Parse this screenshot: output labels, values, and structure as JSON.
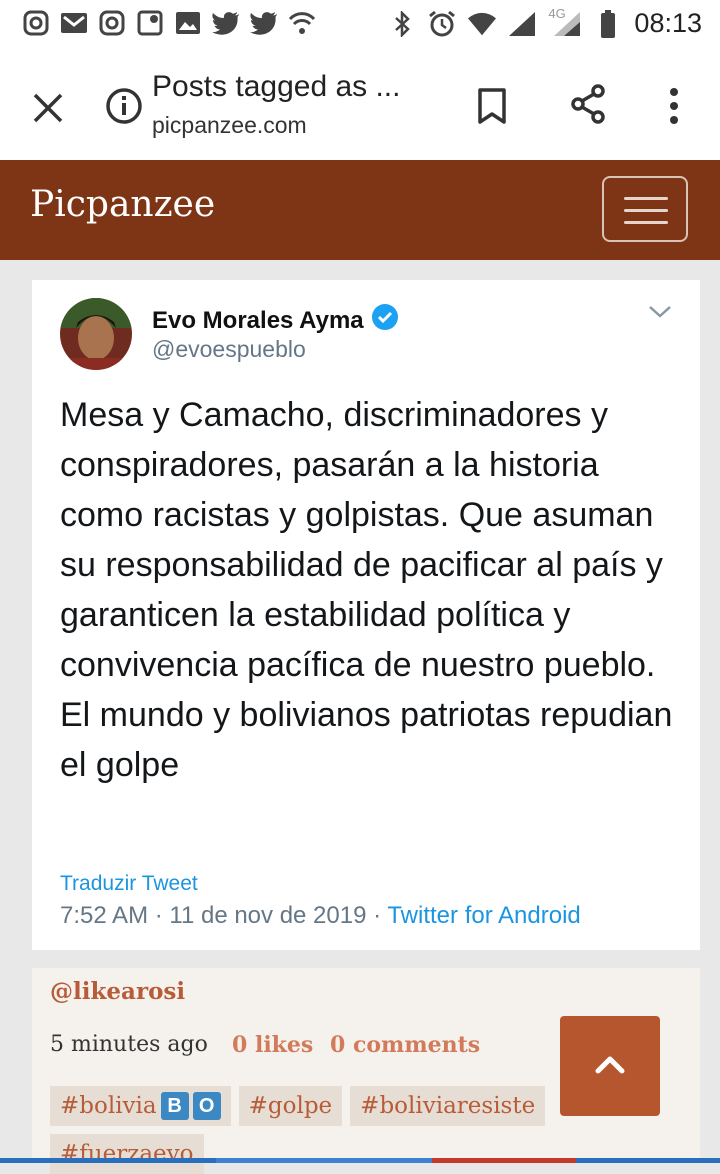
{
  "status_bar": {
    "time": "08:13",
    "network": "4G",
    "left_icons": [
      "instagram-icon",
      "gmail-icon",
      "instagram-icon",
      "maps-icon",
      "image-icon",
      "twitter-icon",
      "twitter-icon",
      "vpn-icon"
    ],
    "right_icons": [
      "bluetooth-icon",
      "alarm-icon",
      "wifi-icon",
      "signal-icon",
      "signal-4g-icon",
      "battery-icon"
    ]
  },
  "toolbar": {
    "title": "Posts tagged as ...",
    "url": "picpanzee.com"
  },
  "site": {
    "brand": "Picpanzee",
    "header_color": "#7e3516"
  },
  "tweet": {
    "name": "Evo Morales Ayma",
    "handle": "@evoespueblo",
    "text": "Mesa y Camacho, discriminadores y conspiradores, pasarán a la historia como racistas y golpistas. Que asuman su responsabilidad de pacificar al país y garanticen la estabilidad política y convivencia pacífica de nuestro pueblo.   El mundo y bolivianos patriotas repudian el golpe",
    "translate": "Traduzir Tweet",
    "timestamp": "7:52 AM · 11 de nov de 2019 · ",
    "source": "Twitter for Android"
  },
  "post": {
    "user": "@likearosi",
    "time": "5 minutes ago",
    "likes": "0 likes",
    "comments": "0 comments",
    "tags": [
      "#bolivia",
      "#golpe",
      "#boliviaresiste",
      "#fuerzaevo"
    ],
    "flag_letters": [
      "B",
      "O"
    ]
  }
}
